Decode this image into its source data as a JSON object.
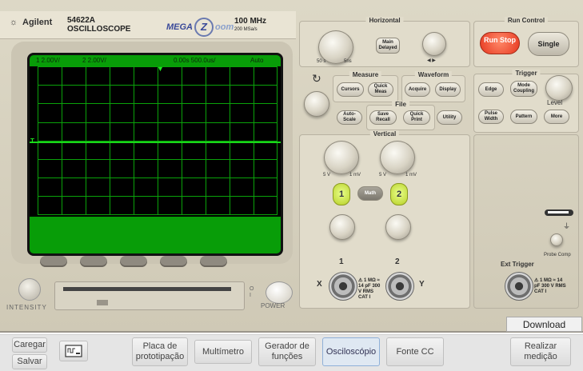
{
  "scope": {
    "brand": "Agilent",
    "model": "54622A",
    "model_sub": "OSCILLOSCOPE",
    "logo_mega": "MEGA",
    "logo_zoom_z": "Z",
    "logo_zoom_rest": "oom",
    "bandwidth": "100 MHz",
    "sample_rate": "200 MSa/s",
    "intensity_label": "INTENSITY",
    "power_label": "POWER",
    "power_on": "O",
    "power_off": "I"
  },
  "screen": {
    "status_left": "1  2.00V/",
    "status_mid": "2  2.00V/",
    "status_right": "0.00s  500.0us/",
    "status_trig": "Auto",
    "ground_marker": "T",
    "trigger_marker": "▼"
  },
  "horizontal": {
    "title": "Horizontal",
    "range_left": "50 s",
    "range_right": "5ns",
    "main_delayed": "Main Delayed",
    "arrows": "◀ ▶"
  },
  "measure": {
    "title": "Measure",
    "cursors": "Cursors",
    "quick_meas": "Quick Meas"
  },
  "waveform": {
    "title": "Waveform",
    "acquire": "Acquire",
    "display": "Display"
  },
  "file": {
    "title": "File",
    "autoscale": "Auto-Scale",
    "save_recall": "Save Recall",
    "quick_print": "Quick Print",
    "utility": "Utility"
  },
  "vertical": {
    "title": "Vertical",
    "range1": "5 V",
    "range1b": "1 mV",
    "range2": "5 V",
    "range2b": "1 mV",
    "ch1": "1",
    "ch2": "2",
    "math": "Math",
    "x_label": "X",
    "y_label": "Y",
    "input_spec": "⚠ 1 MΩ ≈ 14 pF 300 V RMS CAT I"
  },
  "run_control": {
    "title": "Run Control",
    "run_stop": "Run Stop",
    "single": "Single"
  },
  "trigger": {
    "title": "Trigger",
    "edge": "Edge",
    "mode_coupling": "Mode Coupling",
    "level": "Level",
    "pulse_width": "Pulse Width",
    "pattern": "Pattern",
    "more": "More",
    "probe_comp": "Probe Comp",
    "ext_trigger": "Ext Trigger",
    "ext_spec": "⚠ 1 MΩ ≈ 14 pF 300 V RMS CAT I"
  },
  "download_manual": "Download Manual",
  "bottom_bar": {
    "carregar": "Caregar",
    "salvar": "Salvar",
    "placa": "Placa de prototipação",
    "multimetro": "Multímetro",
    "gerador": "Gerador de funções",
    "osciloscopio": "Osciloscópio",
    "fonte": "Fonte CC",
    "realizar": "Realizar medição"
  },
  "colors": {
    "screen_green": "#089d08",
    "trace": "#19d719",
    "run_stop": "#e6361e",
    "channel_button": "#c6dd2c"
  }
}
